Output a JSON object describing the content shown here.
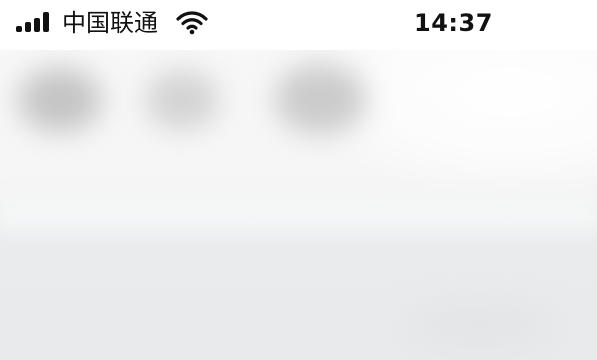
{
  "status_bar": {
    "carrier": "中国联通",
    "time": "14:37",
    "signal_icon": "signal-strength-icon",
    "wifi_icon": "wifi-icon"
  },
  "content": {
    "state": "blurred"
  }
}
